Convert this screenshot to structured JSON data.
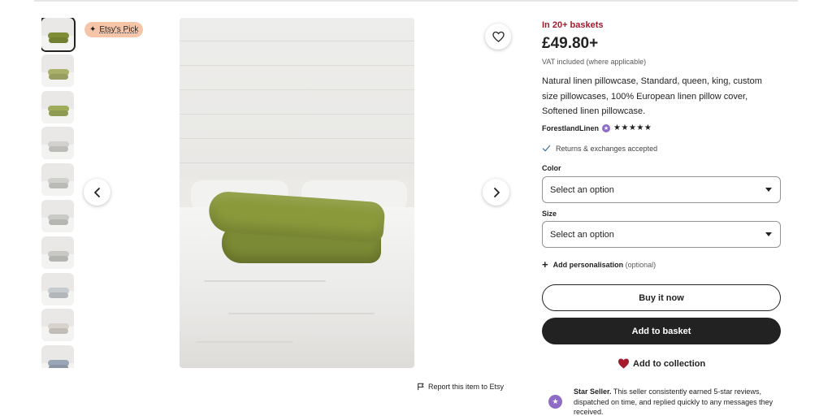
{
  "badge": {
    "label": "Etsy's Pick"
  },
  "thumbnails": [
    {
      "tone": "#7f8e36"
    },
    {
      "tone": "#a9b06a"
    },
    {
      "tone": "#9eac5c"
    },
    {
      "tone": "#d2d1cd"
    },
    {
      "tone": "#cfd0cb"
    },
    {
      "tone": "#cacbc6"
    },
    {
      "tone": "#c8c9c4"
    },
    {
      "tone": "#c6cbd0"
    },
    {
      "tone": "#d8d3cb"
    },
    {
      "tone": "#9aa6b6"
    }
  ],
  "report": {
    "label": "Report this item to Etsy"
  },
  "product": {
    "baskets": "In 20+ baskets",
    "price": "£49.80+",
    "vat": "VAT included (where applicable)",
    "title": "Natural linen pillowcase, Standard, queen, king, custom size pillowcases, 100% European linen pillow cover, Softened linen pillowcase.",
    "shop_name": "ForestlandLinen",
    "rating_stars": "★★★★★",
    "returns": "Returns & exchanges accepted"
  },
  "options": {
    "color_label": "Color",
    "color_value": "Select an option",
    "size_label": "Size",
    "size_value": "Select an option"
  },
  "personalisation": {
    "label": "Add personalisation",
    "note": "(optional)"
  },
  "actions": {
    "buy_now": "Buy it now",
    "add_to_basket": "Add to basket",
    "add_to_collection": "Add to collection"
  },
  "seller": {
    "badge_title": "Star Seller.",
    "description": " This seller consistently earned 5-star reviews, dispatched on time, and replied quickly to any messages they received."
  },
  "colors": {
    "sale_red": "#a61a2e",
    "heart_red": "#a61a2e",
    "star_seller_purple": "#8e6bc6",
    "pick_badge": "#f6c5a8",
    "primary_button": "#222222"
  }
}
